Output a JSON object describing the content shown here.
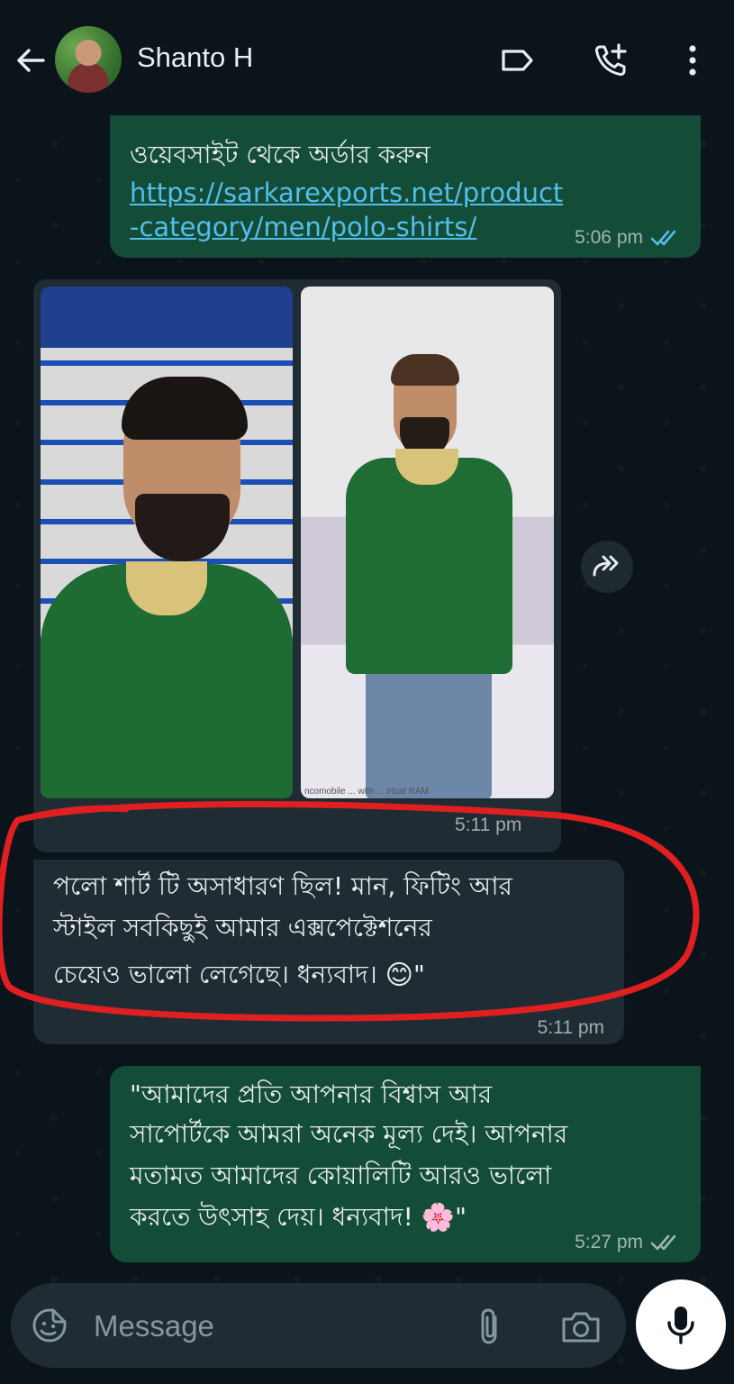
{
  "header": {
    "contact_name": "Shanto H"
  },
  "messages": [
    {
      "id": "m1",
      "direction": "outgoing",
      "partial_line": "ওয়েবসাইট থেকে অর্ডার করুন",
      "link_line1": "https://sarkarexports.net/product",
      "link_line2": "-category/men/polo-shirts/",
      "time": "5:06 pm",
      "status": "read"
    },
    {
      "id": "m2",
      "direction": "incoming",
      "type": "images",
      "image_count": 2,
      "photo2_caption": "ncomobile ... with ... irtual RAM",
      "time": "5:11 pm"
    },
    {
      "id": "m3",
      "direction": "incoming",
      "line1": "পলো শার্ট টি অসাধারণ ছিল! মান, ফিটিং আর",
      "line2": "স্টাইল সবকিছুই আমার এক্সপেক্টেশনের",
      "line3": "চেয়েও ভালো লেগেছে। ধন্যবাদ।",
      "emoji": "😊",
      "trail": "\"",
      "time": "5:11 pm"
    },
    {
      "id": "m4",
      "direction": "outgoing",
      "line1": "\"আমাদের প্রতি আপনার বিশ্বাস আর",
      "line2": "সাপোর্টকে আমরা অনেক মূল্য দেই। আপনার",
      "line3": "মতামত আমাদের কোয়ালিটি আরও ভালো",
      "line4": "করতে উৎসাহ দেয়। ধন্যবাদ!",
      "emoji": "🌸",
      "trail": "\"",
      "time": "5:27 pm",
      "status": "delivered"
    }
  ],
  "input": {
    "placeholder": "Message"
  },
  "colors": {
    "background": "#0b141a",
    "outgoing_bubble": "#144d37",
    "incoming_bubble": "#1f2c33",
    "link": "#53bdeb",
    "read_ticks": "#53bdeb",
    "annotation": "#e02020"
  },
  "icons": [
    "back-arrow-icon",
    "label-icon",
    "add-call-icon",
    "more-options-icon",
    "forward-icon",
    "emoji-sticker-icon",
    "attach-icon",
    "camera-icon",
    "mic-icon",
    "double-check-icon"
  ]
}
